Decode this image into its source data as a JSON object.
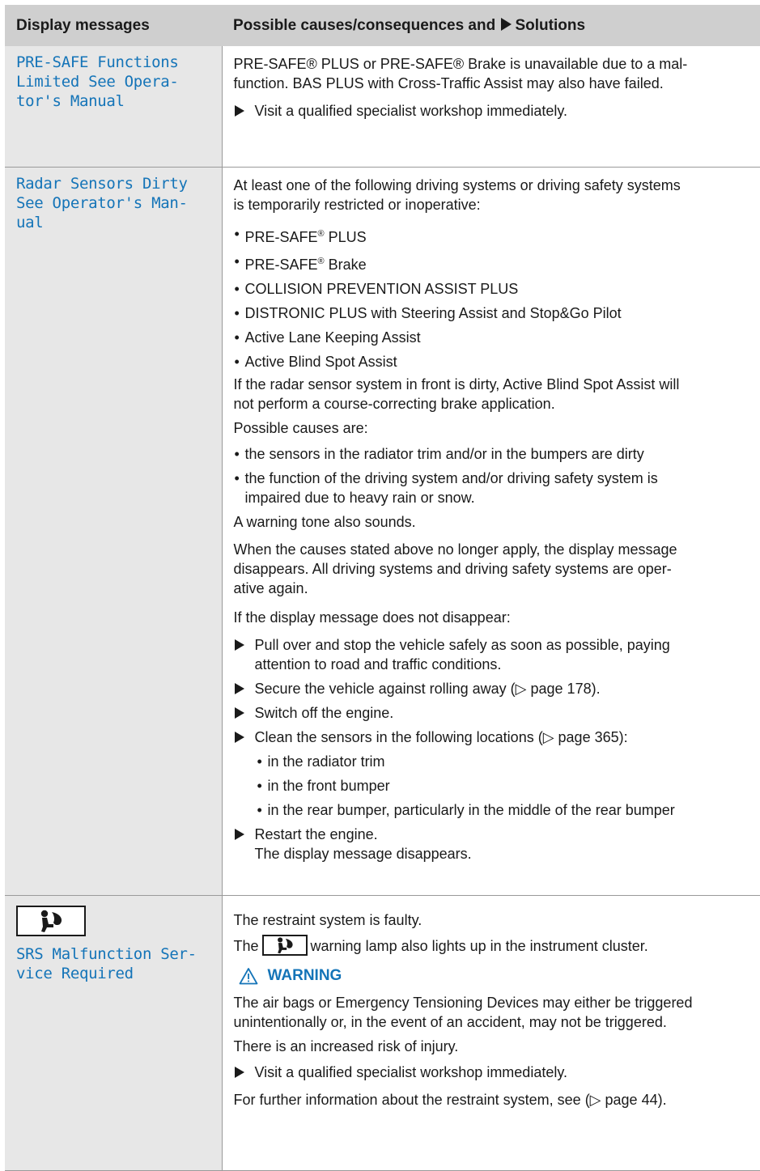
{
  "header": {
    "col1": "Display messages",
    "col2_before": "Possible causes/consequences and",
    "col2_after": "Solutions"
  },
  "rows": [
    {
      "message_lines": [
        "PRE-SAFE Functions",
        "Limited See Opera-",
        "tor's Manual"
      ],
      "body": [
        "PRE-SAFE® PLUS or PRE-SAFE® Brake is unavailable due to a mal-",
        "function. BAS PLUS with Cross-Traffic Assist may also have failed."
      ],
      "step": "Visit a qualified specialist workshop immediately."
    },
    {
      "message_lines": [
        "Radar Sensors Dirty",
        "See Operator's Man-",
        "ual"
      ],
      "intro": [
        "At least one of the following driving systems or driving safety systems",
        "is temporarily restricted or inoperative:"
      ],
      "systems": [
        "PRE-SAFE",
        "PLUS",
        "PRE-SAFE",
        "Brake",
        "COLLISION PREVENTION ASSIST PLUS",
        "DISTRONIC PLUS with Steering Assist and Stop&Go Pilot",
        "Active Lane Keeping Assist",
        "Active Blind Spot Assist"
      ],
      "reg": "®",
      "radar_note": [
        "If the radar sensor system in front is dirty, Active Blind Spot Assist will",
        "not perform a course-correcting brake application."
      ],
      "causes_label": "Possible causes are:",
      "causes": [
        "the sensors in the radiator trim and/or in the bumpers are dirty",
        "the function of the driving system and/or driving safety system is",
        "impaired due to heavy rain or snow."
      ],
      "tone": "A warning tone also sounds.",
      "clear_note": [
        "When the causes stated above no longer apply, the display message",
        "disappears. All driving systems and driving safety systems are oper-",
        "ative again."
      ],
      "not_disappear": "If the display message does not disappear:",
      "steps": [
        "Pull over and stop the vehicle safely as soon as possible, paying",
        "attention to road and traffic conditions.",
        "Secure the vehicle against rolling away (▷ page 178).",
        "Switch off the engine.",
        "Clean the sensors in the following locations (▷ page 365):"
      ],
      "locations": [
        "in the radiator trim",
        "in the front bumper",
        "in the rear bumper, particularly in the middle of the rear bumper"
      ],
      "restart": "Restart the engine.",
      "restart_result": "The display message disappears."
    },
    {
      "icon": "airbag-warning-lamp-icon",
      "message_lines": [
        "SRS Malfunction Ser-",
        "vice Required"
      ],
      "faulty": "The restraint system is faulty.",
      "lamp_before": "The",
      "lamp_after": "warning lamp also lights up in the instrument cluster.",
      "warning_title": "WARNING",
      "warning_text": [
        "The air bags or Emergency Tensioning Devices may either be triggered",
        "unintentionally or, in the event of an accident, may not be triggered.",
        "There is an increased risk of injury."
      ],
      "step": "Visit a qualified specialist workshop immediately.",
      "further": "For further information about the restraint system, see (▷ page 44)."
    }
  ],
  "colors": {
    "message_blue": "#1474b8",
    "header_gray": "#cfcfcf",
    "left_col_gray": "#e7e7e7"
  }
}
